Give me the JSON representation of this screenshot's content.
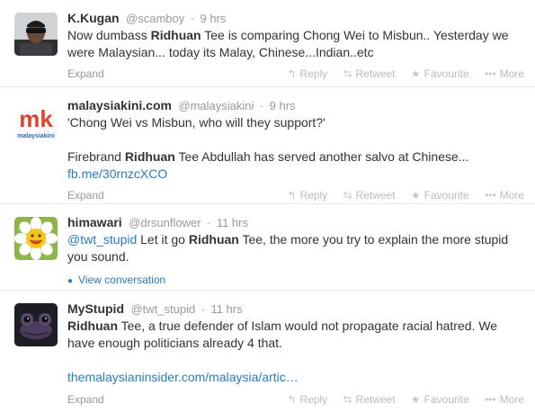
{
  "footer_labels": {
    "expand": "Expand",
    "reply": "Reply",
    "retweet": "Retweet",
    "favourite": "Favourite",
    "more": "More",
    "view_conversation": "View conversation"
  },
  "icons": {
    "reply": "reply-arrow-icon",
    "retweet": "retweet-icon",
    "favourite": "star-icon",
    "more": "ellipsis-icon",
    "conversation": "speech-bubble-icon"
  },
  "colors": {
    "link": "#2b7bb9",
    "muted": "#999999",
    "text": "#333333",
    "malaysiakini_red": "#e8412b",
    "malaysiakini_blue": "#2f67b5"
  },
  "tweets": [
    {
      "name": "K.Kugan",
      "handle": "@scamboy",
      "time": "9 hrs",
      "text_a": "Now dumbass ",
      "bold": "Ridhuan",
      "text_b": " Tee is comparing Chong Wei to Misbun.. Yesterday we were Malaysian... today its Malay, Chinese...Indian..etc"
    },
    {
      "name": "malaysiakini.com",
      "handle": "@malaysiakini",
      "time": "9 hrs",
      "logo_letters": "mk",
      "logo_word": "malaysiakini",
      "line1": "'Chong Wei vs Misbun, who will they support?'",
      "text_a": "Firebrand ",
      "bold": "Ridhuan",
      "text_b": " Tee Abdullah has served another salvo at Chinese...",
      "link": "fb.me/30rnzcXCO"
    },
    {
      "name": "himawari",
      "handle": "@drsunflower",
      "time": "11 hrs",
      "mention": "@twt_stupid",
      "text_a": " Let it go ",
      "bold": "Ridhuan",
      "text_b": " Tee, the more you try to explain the more stupid you sound."
    },
    {
      "name": "MyStupid",
      "handle": "@twt_stupid",
      "time": "11 hrs",
      "bold": "Ridhuan",
      "text_b": " Tee, a true defender of Islam would not propagate racial hatred. We have enough politicians already 4 that.",
      "link": "themalaysianinsider.com/malaysia/artic…"
    }
  ]
}
